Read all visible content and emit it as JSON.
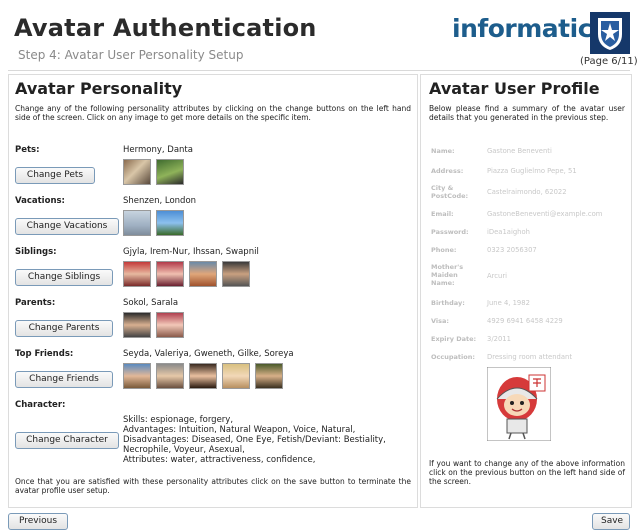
{
  "header": {
    "title": "Avatar Authentication",
    "subtitle": "Step 4: Avatar User Personality Setup",
    "logo_text": "informatics",
    "page": "(Page 6/11)"
  },
  "left": {
    "heading": "Avatar Personality",
    "intro": "Change any of the following personality attributes by clicking on the change buttons on the left hand side of the screen. Click on any image to get more details on the specific item.",
    "rows": [
      {
        "label": "Pets:",
        "value": "Hermony, Danta",
        "button": "Change Pets"
      },
      {
        "label": "Vacations:",
        "value": "Shenzen, London",
        "button": "Change Vacations"
      },
      {
        "label": "Siblings:",
        "value": "Gjyla, Irem-Nur, Ihssan, Swapnil",
        "button": "Change Siblings"
      },
      {
        "label": "Parents:",
        "value": "Sokol, Sarala",
        "button": "Change Parents"
      },
      {
        "label": "Top Friends:",
        "value": "Seyda, Valeriya, Gweneth, Gilke, Soreya",
        "button": "Change Friends"
      }
    ],
    "character": {
      "label": "Character:",
      "button": "Change Character",
      "lines": [
        "Skills: espionage, forgery,",
        "Advantages: Intuition, Natural Weapon, Voice, Natural,",
        "Disadvantages: Diseased, One Eye, Fetish/Deviant: Bestiality,",
        "Necrophile, Voyeur, Asexual,",
        "Attributes: water, attractiveness, confidence,"
      ]
    },
    "footer": "Once that you are satisfied with these personality attributes click on the save button to terminate the avatar profile user setup."
  },
  "right": {
    "heading": "Avatar User Profile",
    "intro": "Below please find a summary of the avatar user details that you generated in the previous step.",
    "fields": [
      {
        "label": "Name:",
        "value": "Gastone Beneventi"
      },
      {
        "label": "Address:",
        "value": "Piazza Guglielmo Pepe, 51"
      },
      {
        "label": "City & PostCode:",
        "value": "Castelraimondo, 62022"
      },
      {
        "label": "Email:",
        "value": "GastoneBeneventi@example.com"
      },
      {
        "label": "Password:",
        "value": "iDea1aighoh"
      },
      {
        "label": "Phone:",
        "value": "0323 2056307"
      },
      {
        "label": "Mother's Maiden Name:",
        "value": "Arcuri"
      },
      {
        "label": "Birthday:",
        "value": "June 4, 1982"
      },
      {
        "label": "Visa:",
        "value": "4929 6941 6458 4229"
      },
      {
        "label": "Expiry Date:",
        "value": "3/2011"
      },
      {
        "label": "Occupation:",
        "value": "Dressing room attendant"
      }
    ],
    "footer": "If you want to change any of the above information click on the previous button on the left hand side of the screen."
  },
  "nav": {
    "previous": "Previous",
    "save": "Save"
  }
}
